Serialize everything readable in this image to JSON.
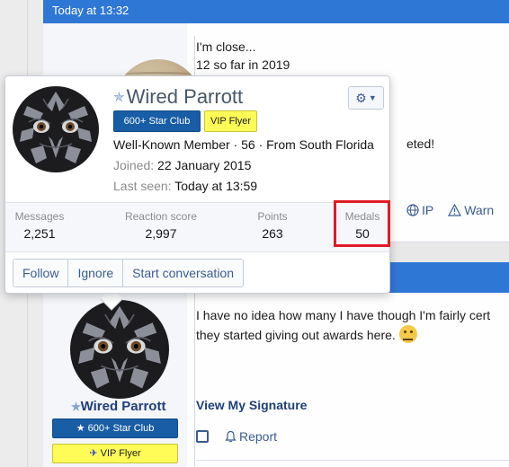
{
  "post1": {
    "timestamp": "Today at 13:32",
    "message_line1": "I'm close...",
    "message_line2": "12 so far in 2019",
    "message_continued": "eted!",
    "actions": {
      "ip": "IP",
      "warn": "Warn"
    }
  },
  "tooltip": {
    "username": "Wired Parrott",
    "badges": {
      "star_club": "600+ Star Club",
      "vip": "VIP Flyer"
    },
    "role_line": "Well-Known Member · 56 · From South Florida",
    "joined_label": "Joined:",
    "joined_value": "22 January 2015",
    "last_seen_label": "Last seen:",
    "last_seen_value": "Today at 13:59",
    "stats": {
      "messages_label": "Messages",
      "messages_value": "2,251",
      "reaction_label": "Reaction score",
      "reaction_value": "2,997",
      "points_label": "Points",
      "points_value": "263",
      "medals_label": "Medals",
      "medals_value": "50"
    },
    "buttons": {
      "follow": "Follow",
      "ignore": "Ignore",
      "conversation": "Start conversation"
    }
  },
  "post2": {
    "username": "Wired Parrott",
    "badge_star": "600+ Star Club",
    "badge_vip": "VIP Flyer",
    "message_line1": "I have no idea how many I have though I'm fairly cert",
    "message_line2": "they started giving out awards here.",
    "signature_link": "View My Signature",
    "report": "Report"
  },
  "colors": {
    "header_blue": "#2f77d4",
    "badge_blue": "#185da5",
    "badge_yellow": "#fffb57",
    "highlight_red": "#e01b24",
    "link": "#3a5c94"
  }
}
